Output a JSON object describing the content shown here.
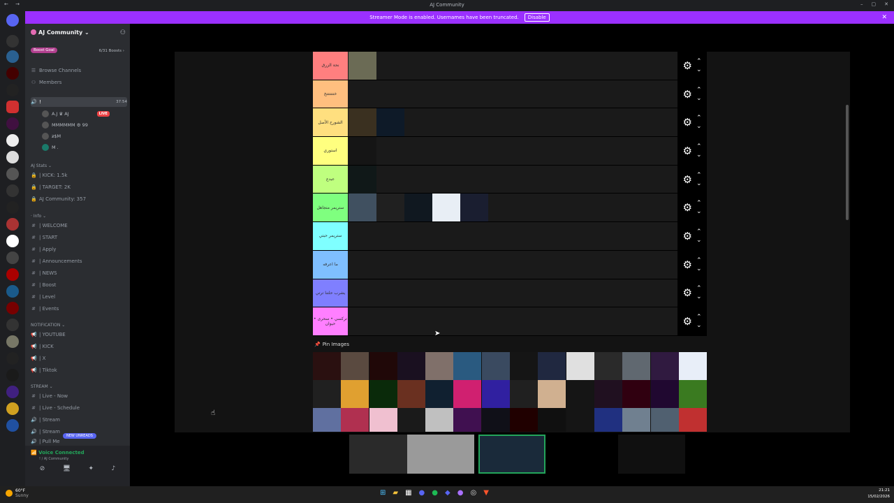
{
  "window": {
    "title": "AJ Community",
    "nav": "← →"
  },
  "banner": {
    "text": "Streamer Mode is enabled. Usernames have been truncated.",
    "disable_label": "Disable"
  },
  "server": {
    "name": "AJ Community ⌄",
    "boost_goal": "Boost Goal",
    "boost_count": "6/31 Boosts ›"
  },
  "nav_rows": {
    "browse": "Browse Channels",
    "members": "Members"
  },
  "voice_channel": {
    "name": "!",
    "timer": "37:54",
    "users": [
      {
        "name": "A.J ♛ AJ",
        "badge": "LIVE"
      },
      {
        "name": "MMMMMM ⚙ 99",
        "badge": ""
      },
      {
        "name": "ƶ$M",
        "badge": ""
      },
      {
        "name": "M .",
        "badge": ""
      }
    ]
  },
  "categories": {
    "stats": "AJ Stats ⌄",
    "info": "· Info ⌄",
    "notification": "NOTIFICATION ⌄",
    "stream": "STREAM ⌄"
  },
  "stats_channels": [
    "| KICK: 1.5k",
    "| TARGET: 2K",
    "AJ Community: 357"
  ],
  "info_channels": [
    "| WELCOME",
    "| START",
    "| Apply",
    "| Announcements",
    "| NEWS",
    "| Boost",
    "| Level",
    "| Events"
  ],
  "notification_channels": [
    "| YOUTUBE",
    "| KICK",
    "| X",
    "| Tiktok"
  ],
  "stream_channels": [
    "| Live - Now",
    "| Live - Schedule",
    "| Stream",
    "| Stream",
    "| Pull Me"
  ],
  "new_unreads": "NEW UNREADS",
  "voice_panel": {
    "status": "Voice Connected",
    "sub": "! / AJ Community"
  },
  "tiers": [
    {
      "label": "نحة الزرق",
      "color": "#ff7f7f",
      "items": [
        "#6b6b55"
      ]
    },
    {
      "label": "ختتتتتتخ",
      "color": "#ffbf7f",
      "items": []
    },
    {
      "label": "الشورح الأصل",
      "color": "#ffdf7f",
      "items": [
        "#3a3020",
        "#0e1a28"
      ]
    },
    {
      "label": "استوري",
      "color": "#ffff7f",
      "items": [
        "#151515"
      ]
    },
    {
      "label": "عبدع",
      "color": "#bfff7f",
      "items": [
        "#101818"
      ]
    },
    {
      "label": "ستريمر متجاهل",
      "color": "#7fff7f",
      "items": [
        "#405060",
        "#202020",
        "#101820",
        "#e8eef5",
        "#1a1e30"
      ]
    },
    {
      "label": "ستريمر حبتي",
      "color": "#7fffff",
      "items": []
    },
    {
      "label": "ما اعرفه",
      "color": "#7fbfff",
      "items": []
    },
    {
      "label": "يشرب حلتنا ترتي",
      "color": "#7f7fff",
      "items": []
    },
    {
      "label": "تركسي • سحرى • حيوان",
      "color": "#ff7fff",
      "items": []
    }
  ],
  "pin_images": "Pin Images",
  "pool_colors": [
    "#2a1010",
    "#5a4a40",
    "#200808",
    "#1a1020",
    "#80706a",
    "#2a5a80",
    "#3a4a60",
    "#151515",
    "#202840",
    "#e0e0e0",
    "#2a2a2a",
    "#606870",
    "#301a40",
    "#e8eef8",
    "#202020",
    "#e0a030",
    "#0a2a0a",
    "#6a3020",
    "#102030",
    "#d02070",
    "#3020a0",
    "#202020",
    "#d0b090",
    "#151515",
    "#201020",
    "#300010",
    "#200830",
    "#3a7a20",
    "#6070a0",
    "#b03050",
    "#f0c0d0",
    "#1a1a1a",
    "#c0c0c0",
    "#401050",
    "#101018",
    "#200000",
    "#101010",
    "#151515",
    "#203080",
    "#708090",
    "#506070",
    "#c03030"
  ],
  "tiles": [
    "#2a2a2a",
    "#9a9a9a",
    "#1a2a3a",
    "#000000",
    "#101010"
  ],
  "taskbar": {
    "temp": "60°F",
    "weather": "Sunny",
    "time": "21:21",
    "date": "15/02/2026"
  }
}
